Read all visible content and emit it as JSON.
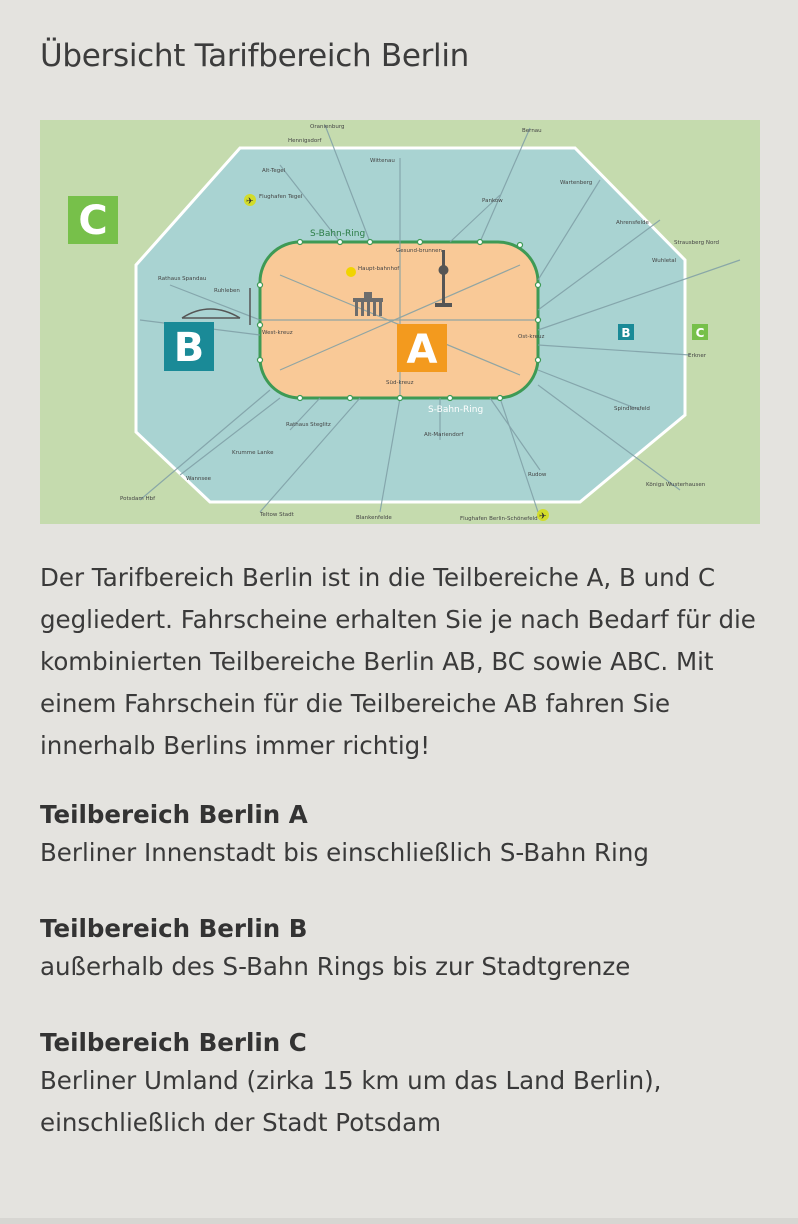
{
  "page": {
    "title": "Übersicht Tarifbereich Berlin"
  },
  "map": {
    "zones": {
      "a": "A",
      "b": "B",
      "c": "C",
      "b_small": "B",
      "c_small": "C"
    },
    "labels": {
      "ring_top": "S-Bahn-Ring",
      "ring_bottom": "S-Bahn-Ring",
      "oranienburg": "Oranienburg",
      "hennigsdorf": "Hennigsdorf",
      "bernau": "Bernau",
      "alt_tegel": "Alt-Tegel",
      "wittenau": "Wittenau",
      "wartenberg": "Wartenberg",
      "flughafen_tegel": "Flughafen Tegel",
      "pankow": "Pankow",
      "ahrensfelde": "Ahrensfelde",
      "strausberg": "Strausberg Nord",
      "wuhletal": "Wuhletal",
      "gesundbrunnen": "Gesund-brunnen",
      "hauptbahnhof": "Haupt-bahnhof",
      "rathaus_spandau": "Rathaus Spandau",
      "ruhleben": "Ruhleben",
      "westkreuz": "West-kreuz",
      "ostkreuz": "Ost-kreuz",
      "erkner": "Erkner",
      "suedkreuz": "Süd-kreuz",
      "rathaus_steglitz": "Rathaus Steglitz",
      "alt_mariendorf": "Alt-Mariendorf",
      "spindlersfeld": "Spindlersfeld",
      "krumme_lanke": "Krumme Lanke",
      "wannsee": "Wannsee",
      "rudow": "Rudow",
      "potsdam": "Potsdam Hbf",
      "koenigs_wusterhausen": "Königs Wusterhausen",
      "teltow_stadt": "Teltow Stadt",
      "blankenfelde": "Blankenfelde",
      "flughafen_schoenefeld": "Flughafen Berlin-Schönefeld"
    },
    "colors": {
      "zone_a": "#f9c997",
      "zone_b": "#a9d3d2",
      "zone_c": "#c5dbae",
      "badge_a": "#f39a1e",
      "badge_b": "#1a8a97",
      "badge_c": "#77c04a"
    }
  },
  "intro": "Der Tarifbereich Berlin ist in die Teilbereiche A, B und C gegliedert. Fahrscheine erhalten Sie je nach Bedarf für die kombinierten Teilbereiche Berlin AB, BC sowie ABC. Mit einem Fahrschein für die Teilbereiche AB fahren Sie innerhalb Berlins immer richtig!",
  "sections": [
    {
      "heading": "Teilbereich Berlin A",
      "text": "Berliner Innenstadt bis einschließlich S-Bahn Ring"
    },
    {
      "heading": "Teilbereich Berlin B",
      "text": "außerhalb des S-Bahn Rings bis zur Stadtgrenze"
    },
    {
      "heading": "Teilbereich Berlin C",
      "text": "Berliner Umland (zirka 15 km um das Land Berlin), einschließlich der Stadt Potsdam"
    }
  ]
}
